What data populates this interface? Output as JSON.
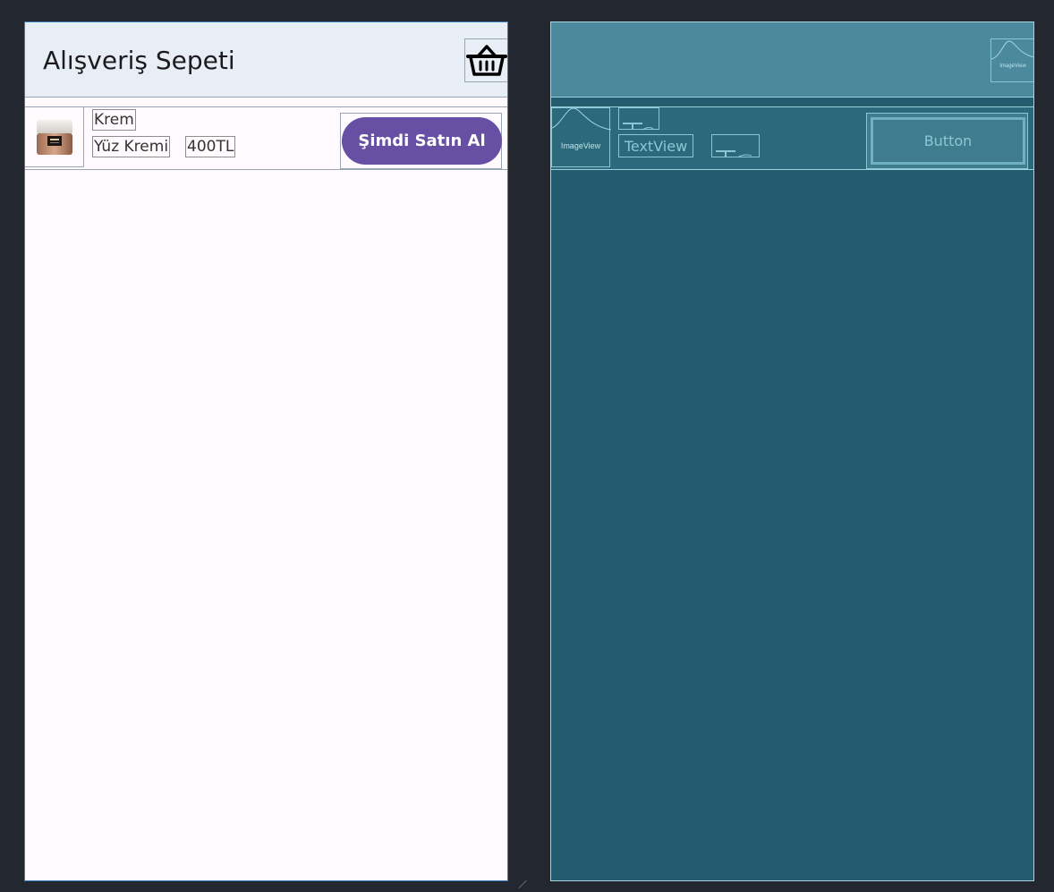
{
  "design": {
    "toolbar": {
      "title": "Alışveriş Sepeti",
      "icon": "basket-icon"
    },
    "item": {
      "image": "cream-jar-image",
      "category": "Krem",
      "name": "Yüz Kremi",
      "price": "400TL",
      "buy_label": "Şimdi Satın Al"
    }
  },
  "blueprint": {
    "toolbar_image_label": "ImageView",
    "row_image_label": "ImageView",
    "textview_label": "TextView",
    "button_label": "Button"
  },
  "colors": {
    "canvas_bg": "#23272f",
    "toolbar_bg": "#e8eef5",
    "button_bg": "#6750a4",
    "blueprint_bg": "#235c6f",
    "blueprint_accent": "#8cc6d4"
  }
}
